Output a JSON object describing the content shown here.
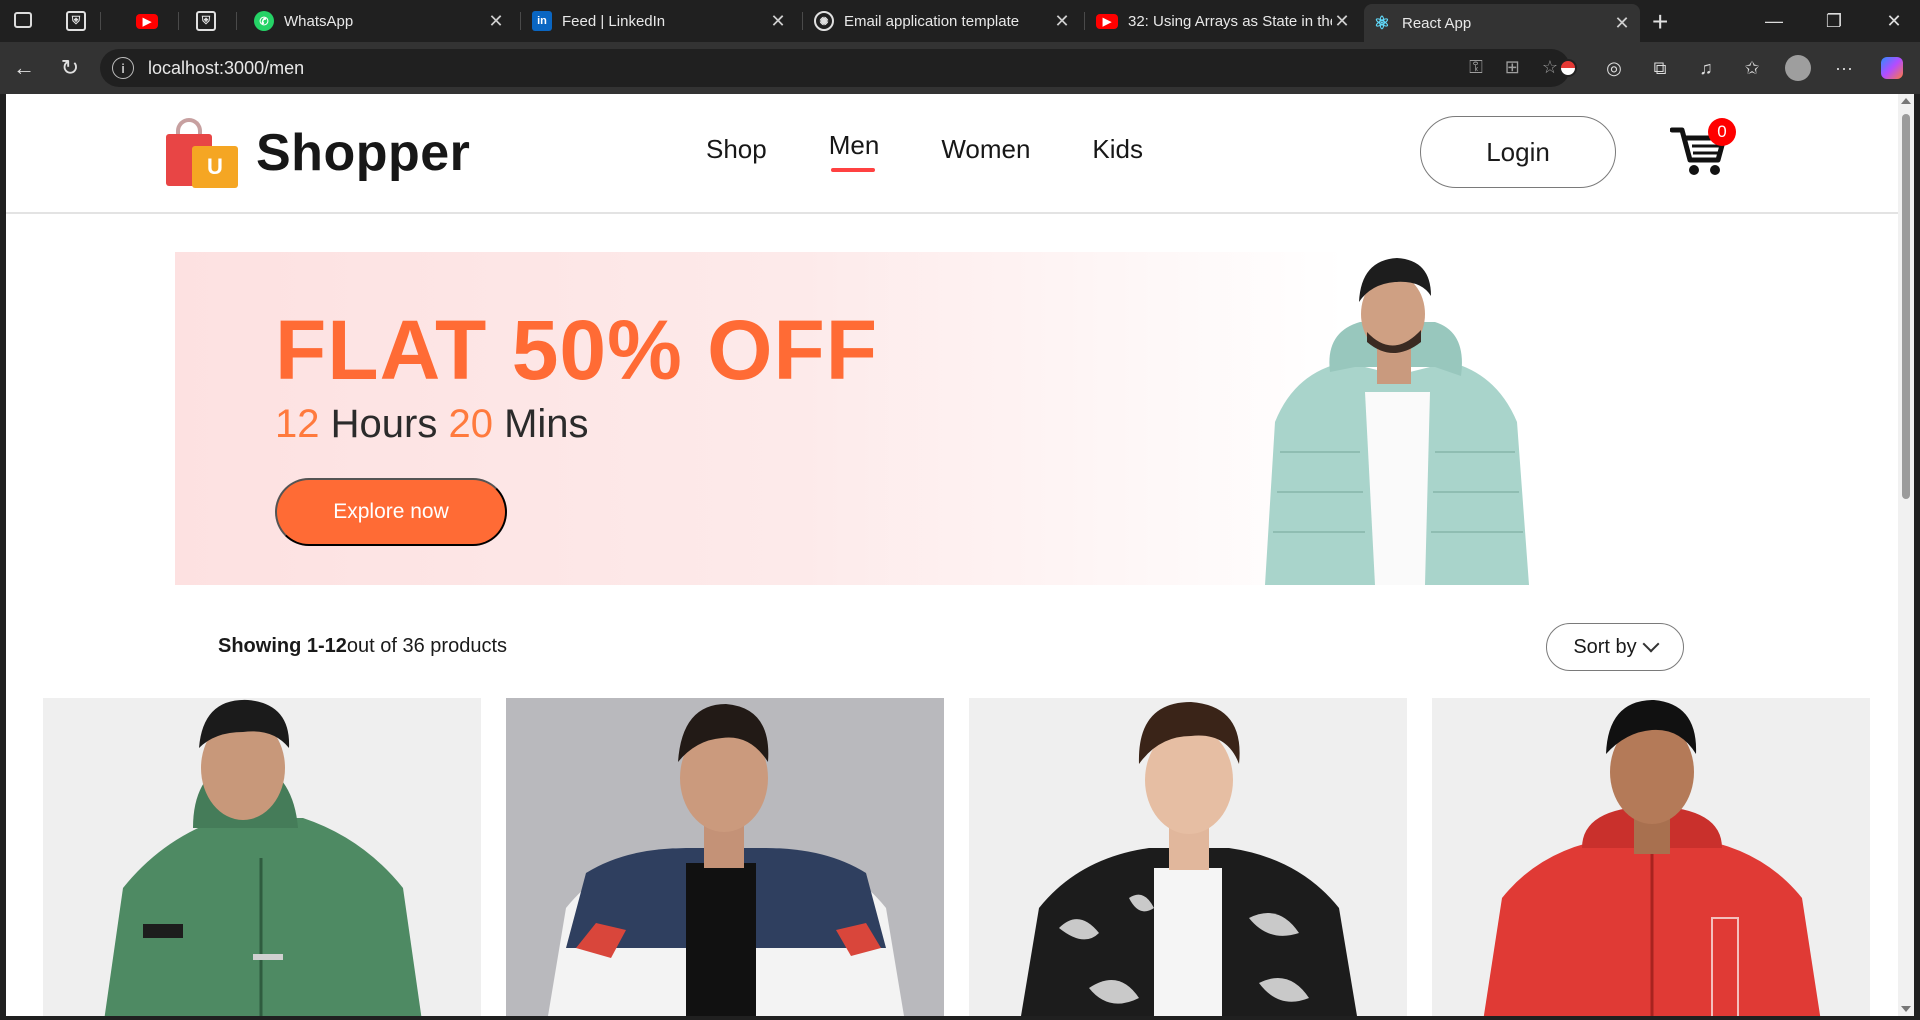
{
  "browser": {
    "tabs": [
      {
        "title": "",
        "icon": "document-shield-icon"
      },
      {
        "title": "",
        "icon": "youtube-icon"
      },
      {
        "title": "",
        "icon": "document-shield-icon"
      },
      {
        "title": "WhatsApp",
        "icon": "whatsapp-icon"
      },
      {
        "title": "Feed | LinkedIn",
        "icon": "linkedin-icon"
      },
      {
        "title": "Email application template",
        "icon": "openai-icon"
      },
      {
        "title": "32: Using Arrays as State in the",
        "icon": "youtube-icon"
      },
      {
        "title": "React App",
        "icon": "react-icon",
        "active": true
      }
    ],
    "url": "localhost:3000/men"
  },
  "site": {
    "brand": "Shopper",
    "logo_letter": "U",
    "nav": [
      {
        "label": "Shop"
      },
      {
        "label": "Men",
        "selected": true
      },
      {
        "label": "Women"
      },
      {
        "label": "Kids"
      }
    ],
    "login_label": "Login",
    "cart_count": "0"
  },
  "hero": {
    "headline": "FLAT 50% OFF",
    "hours_value": "12",
    "hours_label": "Hours",
    "mins_value": "20",
    "mins_label": "Mins",
    "cta_label": "Explore now"
  },
  "listing": {
    "showing_bold": "Showing 1-12",
    "showing_rest": "out of 36 products",
    "sort_label": "Sort by"
  },
  "products": [
    {
      "alt": "Man in green zip hoodie",
      "jacket_color": "#4e8a63",
      "bg": "#efefef"
    },
    {
      "alt": "Man in navy and white puffer jacket",
      "jacket_color": "#2f3f5f",
      "bg": "#b9b9bd"
    },
    {
      "alt": "Man in black and white print bomber jacket",
      "jacket_color": "#1c1c1c",
      "bg": "#efefef"
    },
    {
      "alt": "Man in red hooded jacket",
      "jacket_color": "#e03a35",
      "bg": "#efefef"
    }
  ],
  "colors": {
    "accent": "#ff6b35",
    "nav_underline": "#ff4141",
    "cart_badge": "#ff0000"
  }
}
